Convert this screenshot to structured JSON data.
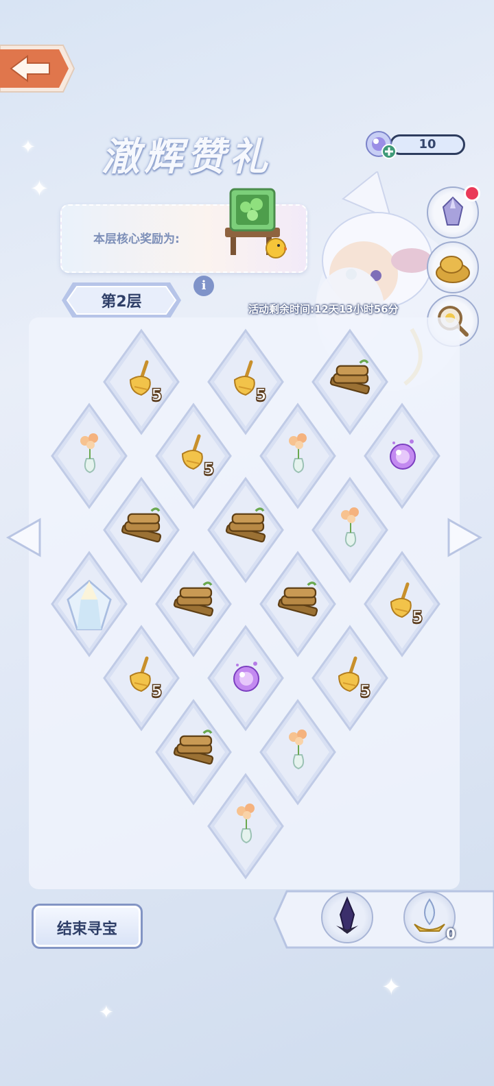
{
  "title": "澈辉赞礼",
  "reward": {
    "label": "本层核心奖励为:"
  },
  "counter": {
    "value": "10"
  },
  "layer": {
    "label": "第2层"
  },
  "timer": {
    "text": "活动剩余时间:12天13小时56分"
  },
  "end_button": {
    "label": "结束寻宝"
  },
  "tray": {
    "item2_qty": "0"
  },
  "colors": {
    "accent": "#7f93c9",
    "dark": "#2f3f68",
    "badge": "#ea3a58"
  },
  "grid": {
    "cells": [
      {
        "item": "broom",
        "qty": "5"
      },
      {
        "item": "broom",
        "qty": "5"
      },
      {
        "item": "wood",
        "qty": ""
      },
      {
        "item": "flower-vase",
        "qty": ""
      },
      {
        "item": "broom",
        "qty": "5"
      },
      {
        "item": "flower-vase",
        "qty": ""
      },
      {
        "item": "purple-orb",
        "qty": ""
      },
      {
        "item": "wood",
        "qty": ""
      },
      {
        "item": "wood",
        "qty": ""
      },
      {
        "item": "flower-vase",
        "qty": ""
      },
      {
        "item": "crystal",
        "qty": ""
      },
      {
        "item": "wood",
        "qty": ""
      },
      {
        "item": "wood",
        "qty": ""
      },
      {
        "item": "broom",
        "qty": "5"
      },
      {
        "item": "broom",
        "qty": "5"
      },
      {
        "item": "purple-orb",
        "qty": ""
      },
      {
        "item": "broom",
        "qty": "5"
      },
      {
        "item": "wood",
        "qty": ""
      },
      {
        "item": "flower-vase",
        "qty": ""
      },
      {
        "item": "flower-vase",
        "qty": ""
      }
    ]
  }
}
